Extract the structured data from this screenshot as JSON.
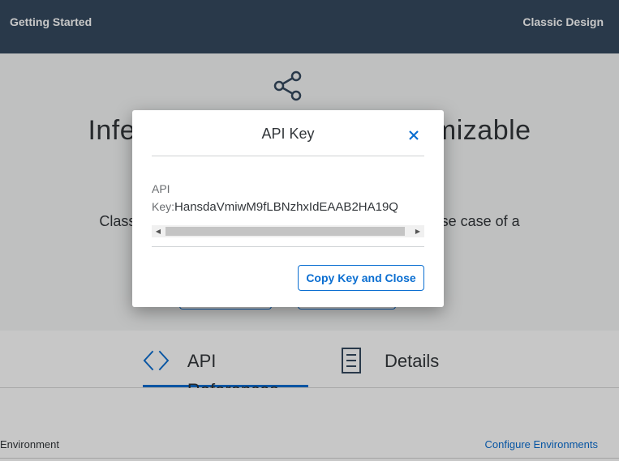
{
  "header": {
    "left_link": "Getting Started",
    "right_link": "Classic Design"
  },
  "hero": {
    "icon": "share-icon",
    "title": "Inference Service for Customizable",
    "description": "Classifies images into categories depending on the use case of a",
    "button1": "",
    "button2": ""
  },
  "tabs": [
    {
      "label": "API References",
      "icon": "code-brackets-icon",
      "selected": true
    },
    {
      "label": "Details",
      "icon": "document-icon",
      "selected": false
    }
  ],
  "environment": {
    "label": "Environment",
    "configure_link": "Configure Environments"
  },
  "dialog": {
    "title": "API Key",
    "close_icon": "close-icon",
    "key_label_line1": "API",
    "key_label_line2": "Key:",
    "key_value": "HansdaVmiwM9fLBNzhxIdEAAB2HA19Q",
    "copy_button": "Copy Key and Close"
  },
  "colors": {
    "header_bg": "#354a5f",
    "accent": "#0a6ed1",
    "text": "#32363a"
  }
}
